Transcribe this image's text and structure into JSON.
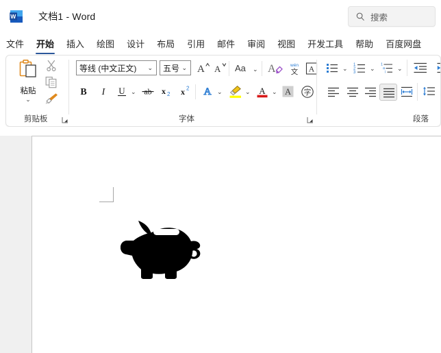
{
  "window": {
    "app_icon": "word-icon",
    "title": "文档1  -  Word"
  },
  "search": {
    "icon": "search-icon",
    "placeholder": "搜索"
  },
  "tabs": [
    {
      "label": "文件",
      "active": false
    },
    {
      "label": "开始",
      "active": true
    },
    {
      "label": "插入",
      "active": false
    },
    {
      "label": "绘图",
      "active": false
    },
    {
      "label": "设计",
      "active": false
    },
    {
      "label": "布局",
      "active": false
    },
    {
      "label": "引用",
      "active": false
    },
    {
      "label": "邮件",
      "active": false
    },
    {
      "label": "审阅",
      "active": false
    },
    {
      "label": "视图",
      "active": false
    },
    {
      "label": "开发工具",
      "active": false
    },
    {
      "label": "帮助",
      "active": false
    },
    {
      "label": "百度网盘",
      "active": false
    }
  ],
  "ribbon": {
    "clipboard": {
      "group_label": "剪贴板",
      "paste_label": "粘贴",
      "paste_caret": "⌄",
      "cut_icon": "scissors-icon",
      "copy_icon": "copy-icon",
      "format_painter_icon": "format-painter-icon",
      "launcher_icon": "dialog-launcher-icon"
    },
    "font": {
      "group_label": "字体",
      "font_name_value": "等线 (中文正文)",
      "font_size_value": "五号",
      "grow_font_label": "A",
      "shrink_font_label": "A",
      "change_case_label": "Aa",
      "clear_format_icon": "clear-formatting-icon",
      "phonetic_guide_icon": "phonetic-guide-icon",
      "phonetic_top_label": "wén",
      "phonetic_bottom_label": "文",
      "character_border_label": "A",
      "bold_label": "B",
      "italic_label": "I",
      "underline_label": "U",
      "strikethrough_label": "ab",
      "subscript_label": "x",
      "subscript_sub": "2",
      "superscript_label": "x",
      "superscript_sup": "2",
      "text_effects_label": "A",
      "highlight_icon": "highlight-color-icon",
      "font_color_label": "A",
      "shading_label": "A",
      "enclose_char_label": "字",
      "caret": "⌄",
      "launcher_icon": "dialog-launcher-icon"
    },
    "paragraph": {
      "group_label": "段落",
      "bullets_icon": "bullet-list-icon",
      "numbering_icon": "numbered-list-icon",
      "multilevel_icon": "multilevel-list-icon",
      "decrease_indent_icon": "decrease-indent-icon",
      "increase_indent_icon": "increase-indent-icon",
      "align_left_icon": "align-left-icon",
      "align_center_icon": "align-center-icon",
      "align_right_icon": "align-right-icon",
      "justify_icon": "justify-icon",
      "distribute_icon": "distribute-icon",
      "line_spacing_icon": "line-spacing-icon",
      "caret": "⌄"
    }
  },
  "document": {
    "margin_marker": "margin-corner-marker",
    "content_icon": "piggy-bank-icon"
  },
  "colors": {
    "accent": "#2b579a",
    "ribbon_border": "#e1e1e1",
    "workspace": "#f0f0f0",
    "page": "#ffffff",
    "highlight_yellow": "#ffff00",
    "font_color_red": "#d81a1a",
    "format_painter_orange": "#e08a1e",
    "list_blue": "#2b7cd3"
  }
}
